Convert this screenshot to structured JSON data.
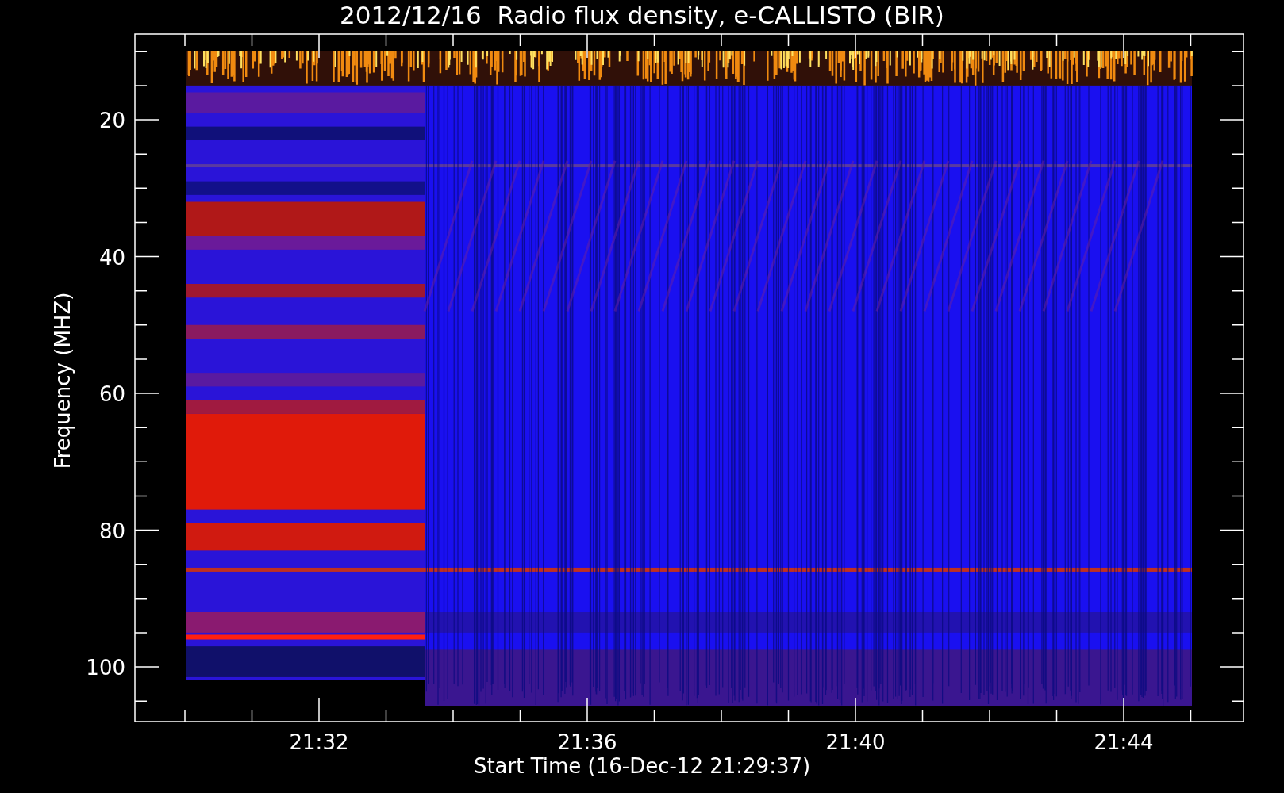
{
  "plot": {
    "title": "2012/12/16  Radio flux density, e-CALLISTO (BIR)",
    "xlabel": "Start Time (16-Dec-12 21:29:37)",
    "ylabel": "Frequency (MHZ)",
    "xticks": [
      "21:32",
      "21:36",
      "21:40",
      "21:44"
    ],
    "yticks": [
      "20",
      "40",
      "60",
      "80",
      "100"
    ]
  }
}
